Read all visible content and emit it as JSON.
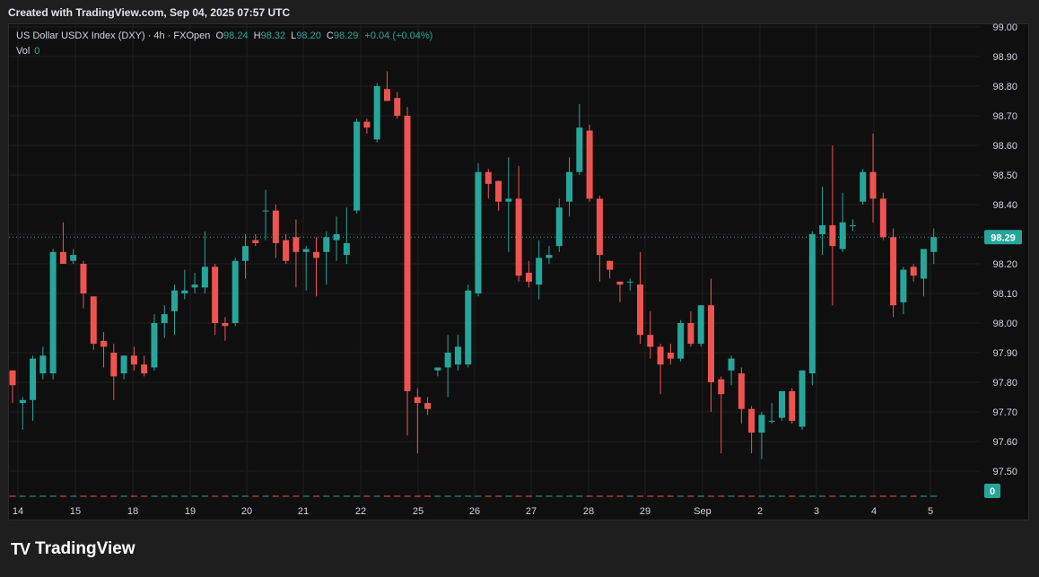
{
  "caption": "Created with TradingView.com, Sep 04, 2025 07:57 UTC",
  "brand": {
    "logo": "TV",
    "name": "TradingView"
  },
  "legend": {
    "symbol": "US Dollar USDX Index (DXY) · 4h · FXOpen",
    "open_label": "O",
    "open": "98.24",
    "high_label": "H",
    "high": "98.32",
    "low_label": "L",
    "low": "98.20",
    "close_label": "C",
    "close": "98.29",
    "change": "+0.04 (+0.04%)",
    "vol_label": "Vol",
    "vol": "0"
  },
  "colors": {
    "up": "#26a69a",
    "down": "#ef5350",
    "background": "#0f0f0f",
    "grid": "#1f1f1f"
  },
  "chart_data": {
    "type": "candlestick",
    "y_axis": {
      "min": 97.5,
      "max": 99.0,
      "ticks": [
        "99.00",
        "98.90",
        "98.80",
        "98.70",
        "98.60",
        "98.50",
        "98.40",
        "98.30",
        "98.20",
        "98.10",
        "98.00",
        "97.90",
        "97.80",
        "97.70",
        "97.60",
        "97.50"
      ],
      "side": "right"
    },
    "x_ticks": [
      "14",
      "15",
      "18",
      "19",
      "20",
      "21",
      "22",
      "25",
      "26",
      "27",
      "28",
      "29",
      "Sep",
      "2",
      "3",
      "4",
      "5"
    ],
    "current_price": "98.29",
    "volume_label": "0",
    "grid": true,
    "candles": [
      {
        "o": 97.84,
        "h": 97.83,
        "l": 97.73,
        "c": 97.79
      },
      {
        "o": 97.73,
        "h": 97.75,
        "l": 97.64,
        "c": 97.74
      },
      {
        "o": 97.74,
        "h": 97.89,
        "l": 97.67,
        "c": 97.88
      },
      {
        "o": 97.83,
        "h": 97.92,
        "l": 97.81,
        "c": 97.89
      },
      {
        "o": 97.83,
        "h": 98.25,
        "l": 97.81,
        "c": 98.24
      },
      {
        "o": 98.24,
        "h": 98.34,
        "l": 98.2,
        "c": 98.2
      },
      {
        "o": 98.21,
        "h": 98.25,
        "l": 98.2,
        "c": 98.23
      },
      {
        "o": 98.2,
        "h": 98.21,
        "l": 98.05,
        "c": 98.1
      },
      {
        "o": 98.09,
        "h": 98.09,
        "l": 97.91,
        "c": 97.93
      },
      {
        "o": 97.94,
        "h": 97.97,
        "l": 97.85,
        "c": 97.92
      },
      {
        "o": 97.9,
        "h": 97.93,
        "l": 97.74,
        "c": 97.82
      },
      {
        "o": 97.83,
        "h": 97.89,
        "l": 97.81,
        "c": 97.89
      },
      {
        "o": 97.89,
        "h": 97.92,
        "l": 97.84,
        "c": 97.86
      },
      {
        "o": 97.86,
        "h": 97.89,
        "l": 97.82,
        "c": 97.83
      },
      {
        "o": 97.85,
        "h": 98.03,
        "l": 97.84,
        "c": 98.0
      },
      {
        "o": 98.0,
        "h": 98.06,
        "l": 97.95,
        "c": 98.03
      },
      {
        "o": 98.04,
        "h": 98.13,
        "l": 97.96,
        "c": 98.11
      },
      {
        "o": 98.1,
        "h": 98.18,
        "l": 98.08,
        "c": 98.11
      },
      {
        "o": 98.12,
        "h": 98.17,
        "l": 98.1,
        "c": 98.13
      },
      {
        "o": 98.12,
        "h": 98.31,
        "l": 98.1,
        "c": 98.19
      },
      {
        "o": 98.19,
        "h": 98.2,
        "l": 97.96,
        "c": 98.0
      },
      {
        "o": 98.0,
        "h": 98.02,
        "l": 97.94,
        "c": 97.99
      },
      {
        "o": 98.0,
        "h": 98.22,
        "l": 97.99,
        "c": 98.21
      },
      {
        "o": 98.21,
        "h": 98.3,
        "l": 98.15,
        "c": 98.26
      },
      {
        "o": 98.28,
        "h": 98.3,
        "l": 98.26,
        "c": 98.27
      },
      {
        "o": 98.38,
        "h": 98.45,
        "l": 98.28,
        "c": 98.38
      },
      {
        "o": 98.38,
        "h": 98.4,
        "l": 98.22,
        "c": 98.27
      },
      {
        "o": 98.28,
        "h": 98.3,
        "l": 98.2,
        "c": 98.21
      },
      {
        "o": 98.29,
        "h": 98.35,
        "l": 98.12,
        "c": 98.24
      },
      {
        "o": 98.24,
        "h": 98.26,
        "l": 98.11,
        "c": 98.25
      },
      {
        "o": 98.24,
        "h": 98.29,
        "l": 98.09,
        "c": 98.22
      },
      {
        "o": 98.24,
        "h": 98.31,
        "l": 98.13,
        "c": 98.29
      },
      {
        "o": 98.28,
        "h": 98.36,
        "l": 98.21,
        "c": 98.3
      },
      {
        "o": 98.23,
        "h": 98.39,
        "l": 98.2,
        "c": 98.27
      },
      {
        "o": 98.38,
        "h": 98.69,
        "l": 98.37,
        "c": 98.68
      },
      {
        "o": 98.68,
        "h": 98.69,
        "l": 98.64,
        "c": 98.66
      },
      {
        "o": 98.62,
        "h": 98.81,
        "l": 98.61,
        "c": 98.8
      },
      {
        "o": 98.79,
        "h": 98.85,
        "l": 98.76,
        "c": 98.75
      },
      {
        "o": 98.76,
        "h": 98.78,
        "l": 98.69,
        "c": 98.7
      },
      {
        "o": 98.7,
        "h": 98.73,
        "l": 97.62,
        "c": 97.77
      },
      {
        "o": 97.75,
        "h": 97.78,
        "l": 97.56,
        "c": 97.73
      },
      {
        "o": 97.73,
        "h": 97.75,
        "l": 97.69,
        "c": 97.71
      },
      {
        "o": 97.84,
        "h": 97.85,
        "l": 97.82,
        "c": 97.85
      },
      {
        "o": 97.85,
        "h": 97.96,
        "l": 97.75,
        "c": 97.9
      },
      {
        "o": 97.86,
        "h": 97.96,
        "l": 97.84,
        "c": 97.92
      },
      {
        "o": 97.86,
        "h": 98.13,
        "l": 97.85,
        "c": 98.11
      },
      {
        "o": 98.1,
        "h": 98.54,
        "l": 98.09,
        "c": 98.51
      },
      {
        "o": 98.51,
        "h": 98.52,
        "l": 98.42,
        "c": 98.47
      },
      {
        "o": 98.48,
        "h": 98.48,
        "l": 98.38,
        "c": 98.41
      },
      {
        "o": 98.41,
        "h": 98.56,
        "l": 98.24,
        "c": 98.42
      },
      {
        "o": 98.42,
        "h": 98.53,
        "l": 98.14,
        "c": 98.16
      },
      {
        "o": 98.17,
        "h": 98.21,
        "l": 98.12,
        "c": 98.14
      },
      {
        "o": 98.13,
        "h": 98.28,
        "l": 98.08,
        "c": 98.22
      },
      {
        "o": 98.22,
        "h": 98.26,
        "l": 98.2,
        "c": 98.23
      },
      {
        "o": 98.26,
        "h": 98.42,
        "l": 98.24,
        "c": 98.39
      },
      {
        "o": 98.41,
        "h": 98.56,
        "l": 98.36,
        "c": 98.51
      },
      {
        "o": 98.51,
        "h": 98.74,
        "l": 98.5,
        "c": 98.66
      },
      {
        "o": 98.65,
        "h": 98.67,
        "l": 98.41,
        "c": 98.42
      },
      {
        "o": 98.42,
        "h": 98.43,
        "l": 98.14,
        "c": 98.23
      },
      {
        "o": 98.21,
        "h": 98.21,
        "l": 98.15,
        "c": 98.18
      },
      {
        "o": 98.14,
        "h": 98.14,
        "l": 98.07,
        "c": 98.13
      },
      {
        "o": 98.14,
        "h": 98.15,
        "l": 98.11,
        "c": 98.14
      },
      {
        "o": 98.13,
        "h": 98.24,
        "l": 97.93,
        "c": 97.96
      },
      {
        "o": 97.96,
        "h": 98.04,
        "l": 97.88,
        "c": 97.92
      },
      {
        "o": 97.92,
        "h": 97.93,
        "l": 97.76,
        "c": 97.86
      },
      {
        "o": 97.9,
        "h": 97.93,
        "l": 97.86,
        "c": 97.88
      },
      {
        "o": 97.88,
        "h": 98.01,
        "l": 97.87,
        "c": 98.0
      },
      {
        "o": 98.0,
        "h": 98.04,
        "l": 97.92,
        "c": 97.93
      },
      {
        "o": 97.93,
        "h": 98.06,
        "l": 97.92,
        "c": 98.06
      },
      {
        "o": 98.06,
        "h": 98.15,
        "l": 97.7,
        "c": 97.8
      },
      {
        "o": 97.81,
        "h": 97.82,
        "l": 97.56,
        "c": 97.76
      },
      {
        "o": 97.84,
        "h": 97.89,
        "l": 97.79,
        "c": 97.88
      },
      {
        "o": 97.83,
        "h": 97.85,
        "l": 97.66,
        "c": 97.71
      },
      {
        "o": 97.71,
        "h": 97.72,
        "l": 97.56,
        "c": 97.63
      },
      {
        "o": 97.63,
        "h": 97.7,
        "l": 97.54,
        "c": 97.69
      },
      {
        "o": 97.67,
        "h": 97.73,
        "l": 97.66,
        "c": 97.67
      },
      {
        "o": 97.68,
        "h": 97.77,
        "l": 97.67,
        "c": 97.77
      },
      {
        "o": 97.77,
        "h": 97.78,
        "l": 97.66,
        "c": 97.67
      },
      {
        "o": 97.65,
        "h": 97.84,
        "l": 97.64,
        "c": 97.84
      },
      {
        "o": 97.83,
        "h": 98.31,
        "l": 97.79,
        "c": 98.3
      },
      {
        "o": 98.3,
        "h": 98.46,
        "l": 98.23,
        "c": 98.33
      },
      {
        "o": 98.33,
        "h": 98.6,
        "l": 98.06,
        "c": 98.26
      },
      {
        "o": 98.25,
        "h": 98.44,
        "l": 98.24,
        "c": 98.34
      },
      {
        "o": 98.33,
        "h": 98.35,
        "l": 98.31,
        "c": 98.33
      },
      {
        "o": 98.41,
        "h": 98.52,
        "l": 98.4,
        "c": 98.51
      },
      {
        "o": 98.51,
        "h": 98.64,
        "l": 98.34,
        "c": 98.42
      },
      {
        "o": 98.42,
        "h": 98.44,
        "l": 98.28,
        "c": 98.29
      },
      {
        "o": 98.29,
        "h": 98.32,
        "l": 98.02,
        "c": 98.06
      },
      {
        "o": 98.07,
        "h": 98.19,
        "l": 98.03,
        "c": 98.18
      },
      {
        "o": 98.19,
        "h": 98.2,
        "l": 98.14,
        "c": 98.16
      },
      {
        "o": 98.15,
        "h": 98.25,
        "l": 98.09,
        "c": 98.25
      },
      {
        "o": 98.24,
        "h": 98.32,
        "l": 98.2,
        "c": 98.29
      }
    ],
    "volumes": [
      1,
      1,
      1,
      1,
      1,
      1,
      1,
      1,
      1,
      1,
      1,
      1,
      1,
      1,
      1,
      1,
      1,
      1,
      1,
      1,
      1,
      1,
      1,
      1,
      1,
      1,
      1,
      1,
      1,
      1,
      1,
      1,
      1,
      1,
      1,
      1,
      1,
      1,
      1,
      1,
      1,
      1,
      1,
      1,
      1,
      1,
      1,
      1,
      1,
      1,
      1,
      1,
      1,
      1,
      1,
      1,
      1,
      1,
      1,
      1,
      1,
      1,
      1,
      1,
      1,
      1,
      1,
      1,
      1,
      1,
      1,
      1,
      1,
      1,
      1,
      1,
      1,
      1,
      1,
      1,
      1,
      1,
      1,
      1,
      1,
      1,
      1,
      1,
      1,
      1,
      1,
      1
    ]
  }
}
